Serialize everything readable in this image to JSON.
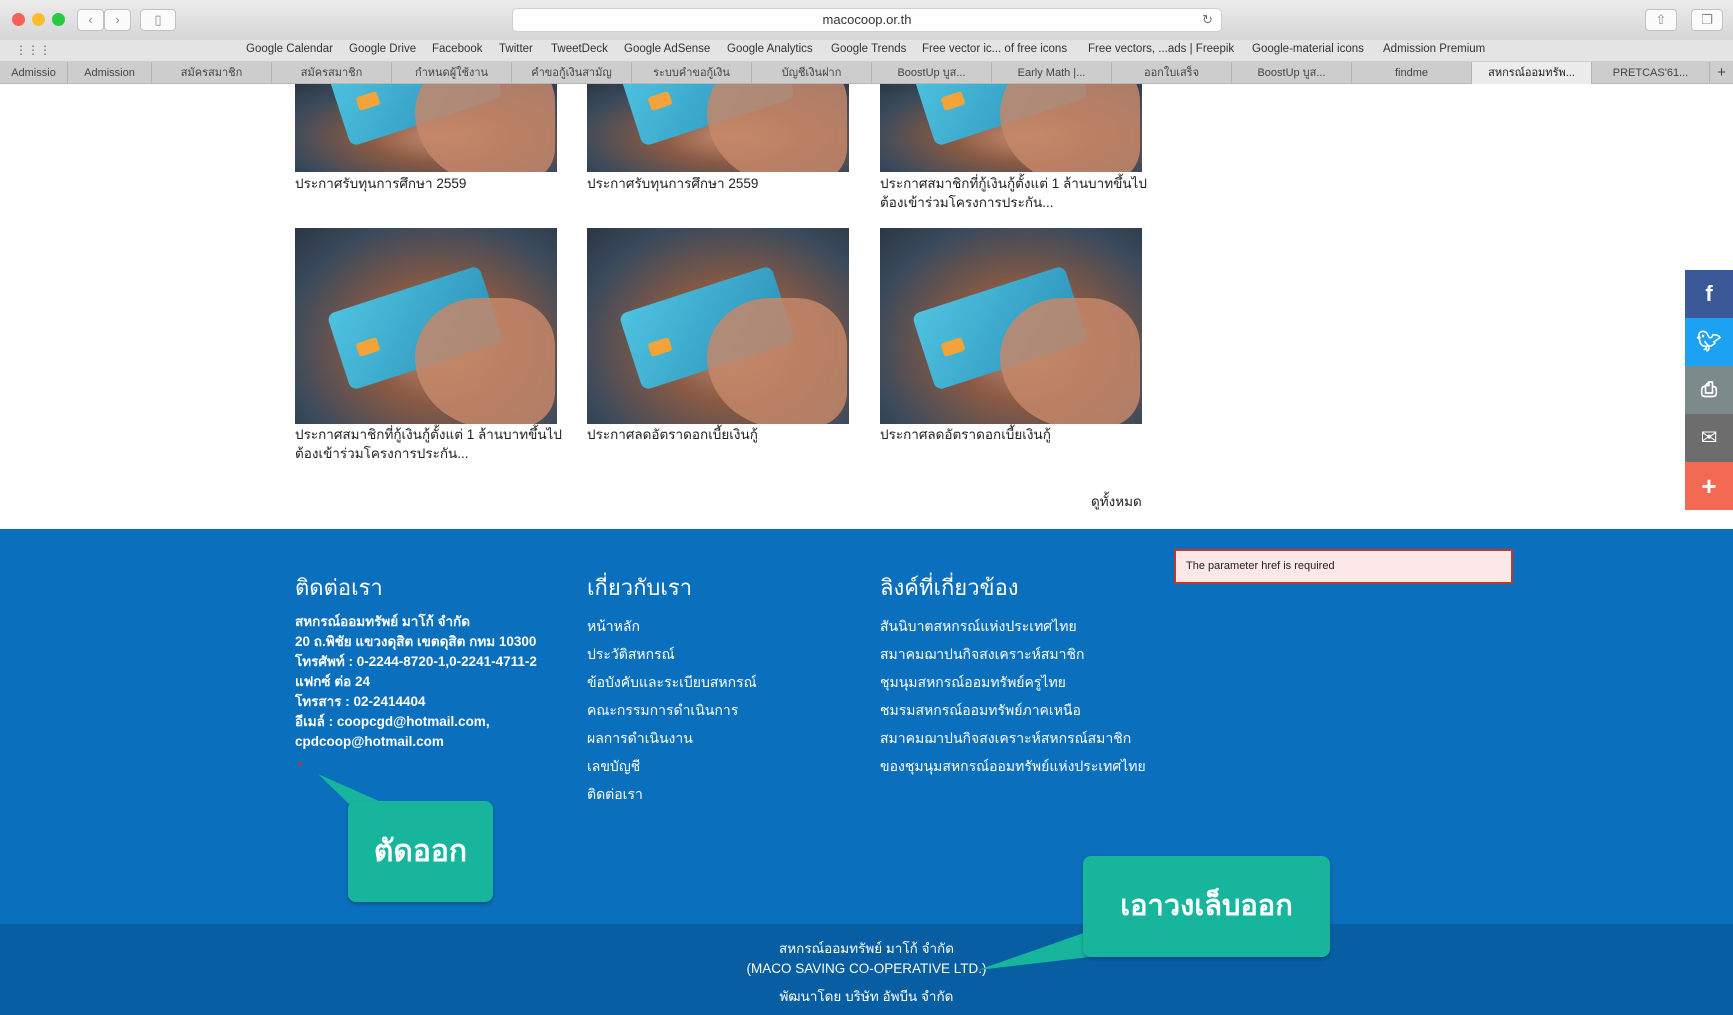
{
  "browser": {
    "url": "macocoop.or.th",
    "bookmarks": [
      "Google Calendar",
      "Google Drive",
      "Facebook",
      "Twitter",
      "TweetDeck",
      "Google AdSense",
      "Google Analytics",
      "Google Trends",
      "Free vector ic... of free icons",
      "Free vectors, ...ads | Freepik",
      "Google-material icons",
      "Admission Premium"
    ],
    "tabs": [
      "Admissio",
      "Admission",
      "สมัครสมาชิก",
      "สมัครสมาชิก",
      "กำหนดผู้ใช้งาน",
      "คำขอกู้เงินสามัญ",
      "ระบบคำขอกู้เงิน",
      "บัญชีเงินฝาก",
      "BoostUp บูส...",
      "Early Math |...",
      "ออกใบเสร็จ",
      "BoostUp บูส...",
      "findme",
      "สหกรณ์ออมทรัพ...",
      "PRETCAS'61..."
    ],
    "new_tab": "+"
  },
  "news": {
    "row1": [
      "ประกาศรับทุนการศึกษา 2559",
      "ประกาศรับทุนการศึกษา 2559",
      "ประกาศสมาชิกที่กู้เงินกู้ตั้งแต่ 1 ล้านบาทขึ้นไปต้องเข้าร่วมโครงการประกัน..."
    ],
    "row2": [
      "ประกาศสมาชิกที่กู้เงินกู้ตั้งแต่ 1 ล้านบาทขึ้นไปต้องเข้าร่วมโครงการประกัน...",
      "ประกาศลดอัตราดอกเบี้ยเงินกู้",
      "ประกาศลดอัตราดอกเบี้ยเงินกู้"
    ],
    "view_all": "ดูทั้งหมด"
  },
  "footer": {
    "contact": {
      "heading": "ติดต่อเรา",
      "lines": [
        "สหกรณ์ออมทรัพย์ มาโก้ จำกัด",
        "20 ถ.พิชัย แขวงดุสิต เขตดุสิต กทม 10300",
        "โทรศัพท์ : 0-2244-8720-1,0-2241-4711-2",
        "แฟกซ์ ต่อ 24",
        "โทรสาร : 02-2414404",
        "อีเมล์ : coopcgd@hotmail.com,",
        "cpdcoop@hotmail.com"
      ]
    },
    "about": {
      "heading": "เกี่ยวกับเรา",
      "links": [
        "หน้าหลัก",
        "ประวัติสหกรณ์",
        "ข้อบังคับและระเบียบสหกรณ์",
        "คณะกรรมการดำเนินการ",
        "ผลการดำเนินงาน",
        "เลขบัญชี",
        "ติดต่อเรา"
      ]
    },
    "related": {
      "heading": "ลิงค์ที่เกี่ยวข้อง",
      "links": [
        "สันนิบาตสหกรณ์แห่งประเทศไทย",
        "สมาคมฌาปนกิจสงเคราะห์สมาชิก",
        "ชุมนุมสหกรณ์ออมทรัพย์ครูไทย",
        "ชมรมสหกรณ์ออมทรัพย์ภาคเหนือ",
        "สมาคมฌาปนกิจสงเคราะห์สหกรณ์สมาชิก",
        "ของชุมนุมสหกรณ์ออมทรัพย์แห่งประเทศไทย"
      ]
    },
    "fb_error": "The parameter href is required",
    "bottom": [
      "สหกรณ์ออมทรัพย์ มาโก้ จำกัด",
      "(MACO SAVING CO-OPERATIVE LTD.)",
      "พัฒนาโดย บริษัท อัพบีน จำกัด"
    ]
  },
  "callouts": {
    "cut": "ตัดออก",
    "remove_brackets": "เอาวงเล็บออก"
  },
  "share": {
    "colors": {
      "facebook": "#3b5998",
      "twitter": "#1da1f2",
      "print": "#7d8a8c",
      "email": "#6d6d6d",
      "more": "#f16a51"
    }
  },
  "colors": {
    "footer": "#0a6fbd",
    "footer_bottom": "#075ea3",
    "callout": "#16b59c"
  }
}
